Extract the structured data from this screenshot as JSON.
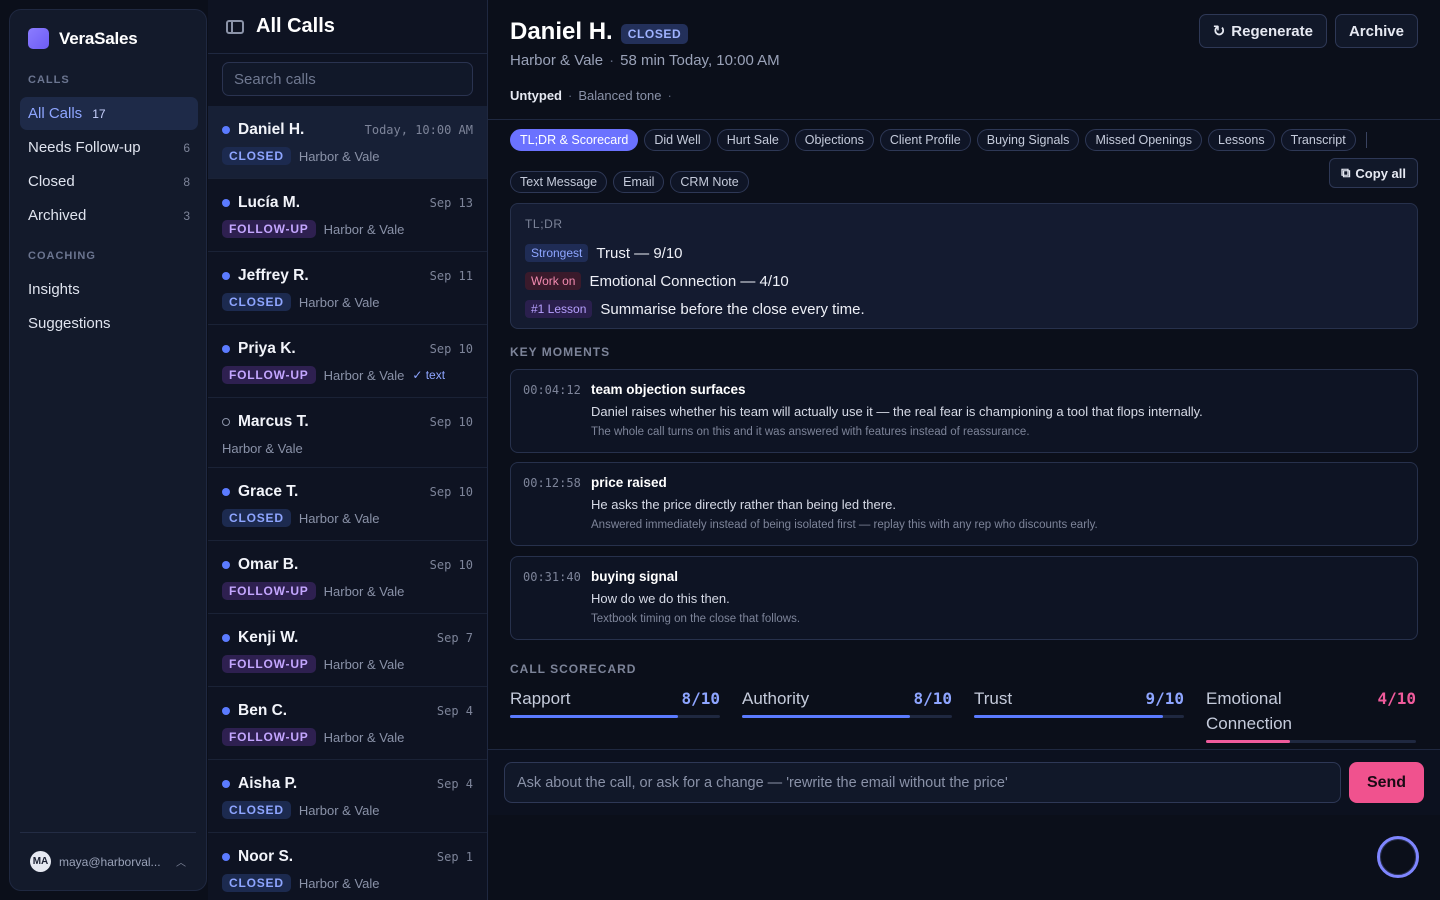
{
  "app": {
    "name": "VeraSales"
  },
  "sidebar": {
    "calls_label": "CALLS",
    "calls_items": [
      {
        "label": "All Calls",
        "count": "17",
        "active": true
      },
      {
        "label": "Needs Follow-up",
        "count": "6"
      },
      {
        "label": "Closed",
        "count": "8"
      },
      {
        "label": "Archived",
        "count": "3"
      }
    ],
    "coaching_label": "COACHING",
    "coaching_items": [
      {
        "label": "Insights"
      },
      {
        "label": "Suggestions"
      }
    ],
    "user": {
      "initials": "MA",
      "email": "maya@harborval..."
    }
  },
  "list": {
    "title": "All Calls",
    "search_placeholder": "Search calls",
    "calls": [
      {
        "name": "Daniel H.",
        "date": "Today, 10:00 AM",
        "badge": "CLOSED",
        "company": "Harbor & Vale"
      },
      {
        "name": "Lucía M.",
        "date": "Sep 13",
        "badge": "FOLLOW-UP",
        "company": "Harbor & Vale"
      },
      {
        "name": "Jeffrey R.",
        "date": "Sep 11",
        "badge": "CLOSED",
        "company": "Harbor & Vale"
      },
      {
        "name": "Priya K.",
        "date": "Sep 10",
        "badge": "FOLLOW-UP",
        "company": "Harbor & Vale",
        "extra": "✓ text"
      },
      {
        "name": "Marcus T.",
        "date": "Sep 10",
        "badge": "",
        "company": "Harbor & Vale"
      },
      {
        "name": "Grace T.",
        "date": "Sep 10",
        "badge": "CLOSED",
        "company": "Harbor & Vale"
      },
      {
        "name": "Omar B.",
        "date": "Sep 10",
        "badge": "FOLLOW-UP",
        "company": "Harbor & Vale"
      },
      {
        "name": "Kenji W.",
        "date": "Sep 7",
        "badge": "FOLLOW-UP",
        "company": "Harbor & Vale"
      },
      {
        "name": "Ben C.",
        "date": "Sep 4",
        "badge": "FOLLOW-UP",
        "company": "Harbor & Vale"
      },
      {
        "name": "Aisha P.",
        "date": "Sep 4",
        "badge": "CLOSED",
        "company": "Harbor & Vale"
      },
      {
        "name": "Noor S.",
        "date": "Sep 1",
        "badge": "CLOSED",
        "company": "Harbor & Vale"
      }
    ]
  },
  "detail": {
    "name": "Daniel H.",
    "status": "CLOSED",
    "company": "Harbor & Vale",
    "duration_time": "58 min Today, 10:00 AM",
    "type": "Untyped",
    "tone": "Balanced tone",
    "regenerate_label": "Regenerate",
    "archive_label": "Archive",
    "copy_all_label": "Copy all",
    "tabs": [
      "TL;DR & Scorecard",
      "Did Well",
      "Hurt Sale",
      "Objections",
      "Client Profile",
      "Buying Signals",
      "Missed Openings",
      "Lessons",
      "Transcript",
      "Text Message",
      "Email",
      "CRM Note"
    ],
    "tldr": {
      "label": "TL;DR",
      "strongest_tag": "Strongest",
      "strongest_text": "Trust — 9/10",
      "work_tag": "Work on",
      "work_text": "Emotional Connection — 4/10",
      "lesson_tag": "#1 Lesson",
      "lesson_text": "Summarise before the close every time."
    },
    "key_moments_label": "KEY MOMENTS",
    "moments": [
      {
        "time": "00:04:12",
        "title": "team objection surfaces",
        "desc": "Daniel raises whether his team will actually use it — the real fear is championing a tool that flops internally.",
        "note": "The whole call turns on this and it was answered with features instead of reassurance."
      },
      {
        "time": "00:12:58",
        "title": "price raised",
        "desc": "He asks the price directly rather than being led there.",
        "note": "Answered immediately instead of being isolated first — replay this with any rep who discounts early."
      },
      {
        "time": "00:31:40",
        "title": "buying signal",
        "desc": "How do we do this then.",
        "note": "Textbook timing on the close that follows."
      }
    ],
    "scorecard_label": "CALL SCORECARD",
    "scores": [
      {
        "name": "Rapport",
        "value": "8/10",
        "fraction": 0.8
      },
      {
        "name": "Authority",
        "value": "8/10",
        "fraction": 0.8
      },
      {
        "name": "Trust",
        "value": "9/10",
        "fraction": 0.9
      },
      {
        "name": "Emotional Connection",
        "value": "4/10",
        "fraction": 0.4
      }
    ]
  },
  "chat": {
    "placeholder": "Ask about the call, or ask for a change — 'rewrite the email without the price'",
    "send_label": "Send"
  }
}
